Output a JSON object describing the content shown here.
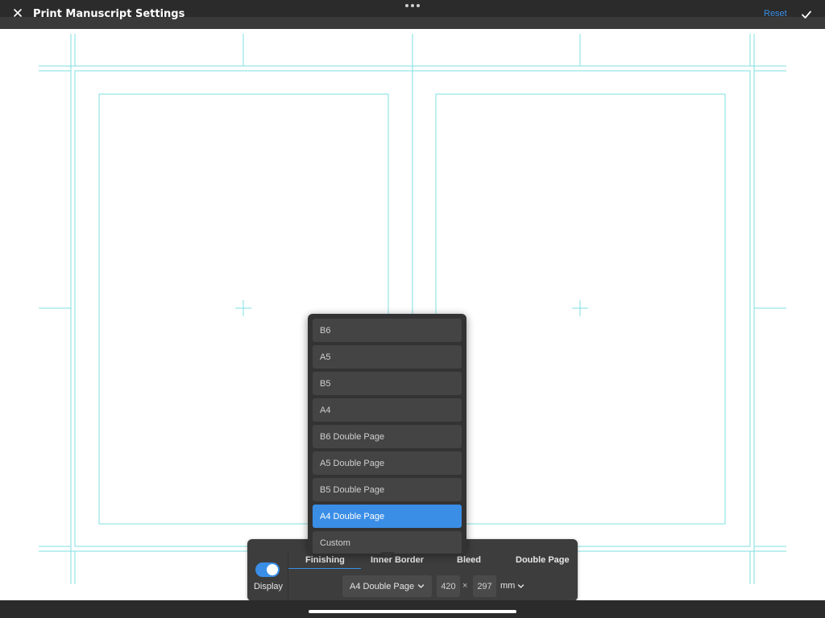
{
  "header": {
    "title": "Print Manuscript Settings",
    "reset_label": "Reset",
    "close_icon": "close-icon",
    "confirm_icon": "checkmark-icon",
    "more_icon": "ellipsis-icon"
  },
  "guides": {
    "color": "#7fdfe0"
  },
  "settings_panel": {
    "display_label": "Display",
    "display_on": true,
    "tabs": [
      {
        "label": "Finishing",
        "active": true
      },
      {
        "label": "Inner Border",
        "active": false
      },
      {
        "label": "Bleed",
        "active": false
      },
      {
        "label": "Double Page",
        "active": false
      }
    ],
    "size_select": {
      "value": "A4 Double Page"
    },
    "width": "420",
    "height": "297",
    "times": "×",
    "unit": "mm"
  },
  "size_dropdown": {
    "options": [
      "B6",
      "A5",
      "B5",
      "A4",
      "B6 Double Page",
      "A5 Double Page",
      "B5 Double Page",
      "A4 Double Page",
      "Custom"
    ],
    "selected": "A4 Double Page"
  },
  "colors": {
    "accent": "#3a8ee6",
    "bar": "#2b2b2b",
    "panel": "#3d3d3d"
  }
}
